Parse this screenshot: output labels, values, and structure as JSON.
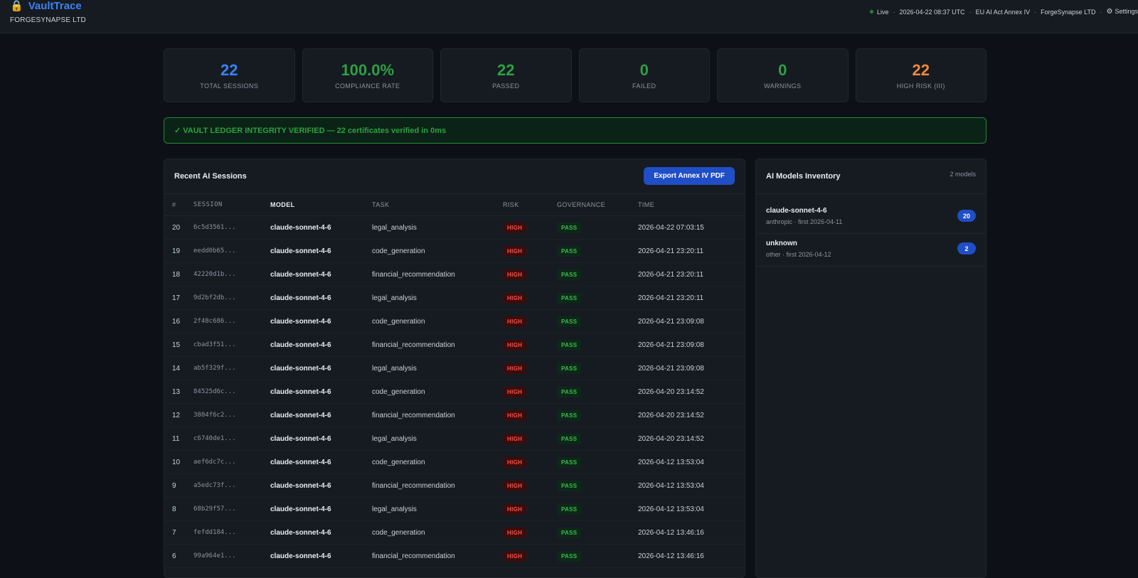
{
  "header": {
    "app_icon": "lock-icon",
    "app_name": "VaultTrace",
    "org": "FORGESYNAPSE LTD",
    "status": {
      "live": "Live",
      "timestamp": "2026-04-22 08:37 UTC",
      "regulation": "EU AI Act Annex IV",
      "company": "ForgeSynapse LTD",
      "settings": "Settings"
    }
  },
  "kpis": [
    {
      "value": "22",
      "label": "TOTAL SESSIONS",
      "color": "#3b82f6"
    },
    {
      "value": "100.0%",
      "label": "COMPLIANCE RATE",
      "color": "#2ea043"
    },
    {
      "value": "22",
      "label": "PASSED",
      "color": "#2ea043"
    },
    {
      "value": "0",
      "label": "FAILED",
      "color": "#2ea043"
    },
    {
      "value": "0",
      "label": "WARNINGS",
      "color": "#2ea043"
    },
    {
      "value": "22",
      "label": "HIGH RISK (III)",
      "color": "#f0883e"
    }
  ],
  "integrity_banner": "✓ VAULT LEDGER INTEGRITY VERIFIED — 22 certificates verified in 0ms",
  "sessions": {
    "title": "Recent AI Sessions",
    "export_label": "Export Annex IV PDF",
    "columns": [
      "#",
      "SESSION",
      "MODEL",
      "TASK",
      "RISK",
      "GOVERNANCE",
      "TIME"
    ],
    "rows": [
      {
        "num": "20",
        "session": "6c5d3561...",
        "model": "claude-sonnet-4-6",
        "task": "legal_analysis",
        "risk": "HIGH",
        "governance": "PASS",
        "time": "2026-04-22 07:03:15"
      },
      {
        "num": "19",
        "session": "eedd0b65...",
        "model": "claude-sonnet-4-6",
        "task": "code_generation",
        "risk": "HIGH",
        "governance": "PASS",
        "time": "2026-04-21 23:20:11"
      },
      {
        "num": "18",
        "session": "42220d1b...",
        "model": "claude-sonnet-4-6",
        "task": "financial_recommendation",
        "risk": "HIGH",
        "governance": "PASS",
        "time": "2026-04-21 23:20:11"
      },
      {
        "num": "17",
        "session": "9d2bf2db...",
        "model": "claude-sonnet-4-6",
        "task": "legal_analysis",
        "risk": "HIGH",
        "governance": "PASS",
        "time": "2026-04-21 23:20:11"
      },
      {
        "num": "16",
        "session": "2f48c686...",
        "model": "claude-sonnet-4-6",
        "task": "code_generation",
        "risk": "HIGH",
        "governance": "PASS",
        "time": "2026-04-21 23:09:08"
      },
      {
        "num": "15",
        "session": "cbad3f51...",
        "model": "claude-sonnet-4-6",
        "task": "financial_recommendation",
        "risk": "HIGH",
        "governance": "PASS",
        "time": "2026-04-21 23:09:08"
      },
      {
        "num": "14",
        "session": "ab5f329f...",
        "model": "claude-sonnet-4-6",
        "task": "legal_analysis",
        "risk": "HIGH",
        "governance": "PASS",
        "time": "2026-04-21 23:09:08"
      },
      {
        "num": "13",
        "session": "84525d6c...",
        "model": "claude-sonnet-4-6",
        "task": "code_generation",
        "risk": "HIGH",
        "governance": "PASS",
        "time": "2026-04-20 23:14:52"
      },
      {
        "num": "12",
        "session": "3804f6c2...",
        "model": "claude-sonnet-4-6",
        "task": "financial_recommendation",
        "risk": "HIGH",
        "governance": "PASS",
        "time": "2026-04-20 23:14:52"
      },
      {
        "num": "11",
        "session": "c6740de1...",
        "model": "claude-sonnet-4-6",
        "task": "legal_analysis",
        "risk": "HIGH",
        "governance": "PASS",
        "time": "2026-04-20 23:14:52"
      },
      {
        "num": "10",
        "session": "aef6dc7c...",
        "model": "claude-sonnet-4-6",
        "task": "code_generation",
        "risk": "HIGH",
        "governance": "PASS",
        "time": "2026-04-12 13:53:04"
      },
      {
        "num": "9",
        "session": "a5edc73f...",
        "model": "claude-sonnet-4-6",
        "task": "financial_recommendation",
        "risk": "HIGH",
        "governance": "PASS",
        "time": "2026-04-12 13:53:04"
      },
      {
        "num": "8",
        "session": "68b29f57...",
        "model": "claude-sonnet-4-6",
        "task": "legal_analysis",
        "risk": "HIGH",
        "governance": "PASS",
        "time": "2026-04-12 13:53:04"
      },
      {
        "num": "7",
        "session": "fefdd184...",
        "model": "claude-sonnet-4-6",
        "task": "code_generation",
        "risk": "HIGH",
        "governance": "PASS",
        "time": "2026-04-12 13:46:16"
      },
      {
        "num": "6",
        "session": "99a964e1...",
        "model": "claude-sonnet-4-6",
        "task": "financial_recommendation",
        "risk": "HIGH",
        "governance": "PASS",
        "time": "2026-04-12 13:46:16"
      }
    ]
  },
  "inventory": {
    "title": "AI Models Inventory",
    "count_label": "2 models",
    "models": [
      {
        "name": "claude-sonnet-4-6",
        "meta": "anthropic · first 2026-04-11",
        "count": "20"
      },
      {
        "name": "unknown",
        "meta": "other · first 2026-04-12",
        "count": "2"
      }
    ]
  }
}
